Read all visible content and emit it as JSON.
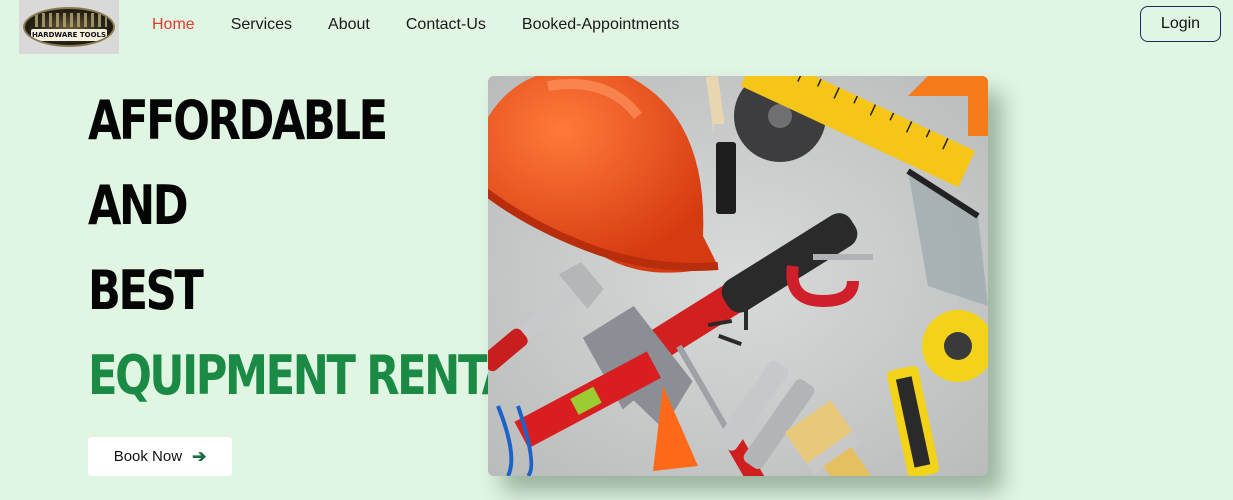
{
  "brand": {
    "logo_text": "HARDWARE TOOLS"
  },
  "nav": {
    "items": [
      {
        "label": "Home",
        "active": true
      },
      {
        "label": "Services",
        "active": false
      },
      {
        "label": "About",
        "active": false
      },
      {
        "label": "Contact-Us",
        "active": false
      },
      {
        "label": "Booked-Appointments",
        "active": false
      }
    ],
    "login_label": "Login"
  },
  "hero": {
    "lines": [
      "AFFORDABLE",
      "AND",
      "BEST",
      "EQUIPMENT RENTA"
    ],
    "book_label": "Book Now",
    "book_icon": "arrow-right-icon"
  },
  "colors": {
    "background": "#e1f5e3",
    "active_nav": "#e03a2e",
    "highlight_green": "#1b8a45",
    "login_border": "#1f2a5c"
  }
}
